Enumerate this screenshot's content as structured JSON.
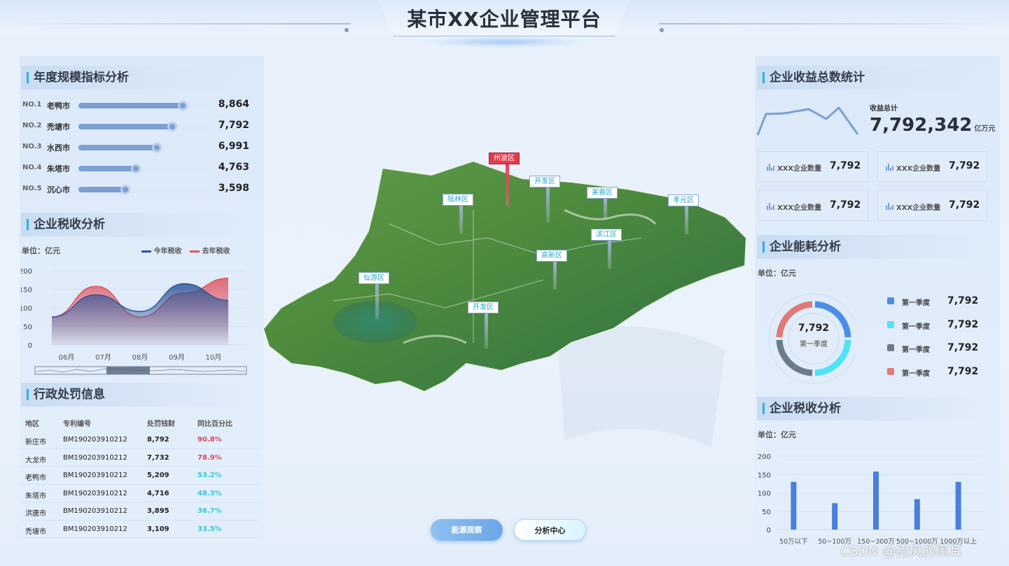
{
  "header": {
    "title": "某市XX企业管理平台"
  },
  "scale": {
    "title": "年度规模指标分析",
    "rows": [
      {
        "no": "NO.1",
        "city": "老鸭市",
        "value": "8,864",
        "ratio": 0.8
      },
      {
        "no": "NO.2",
        "city": "禿塘市",
        "value": "7,792",
        "ratio": 0.72
      },
      {
        "no": "NO.3",
        "city": "水西市",
        "value": "6,991",
        "ratio": 0.6
      },
      {
        "no": "NO.4",
        "city": "朱塔市",
        "value": "4,763",
        "ratio": 0.44
      },
      {
        "no": "NO.5",
        "city": "沉心市",
        "value": "3,598",
        "ratio": 0.36
      }
    ]
  },
  "tax_left": {
    "title": "企业税收分析",
    "unit": "单位：亿元",
    "legend": [
      "今年税收",
      "去年税收"
    ],
    "colors": {
      "this_year": "#2f5597",
      "last_year": "#e0545f"
    },
    "chart_data": {
      "type": "area",
      "x": [
        "06月",
        "07月",
        "08月",
        "09月",
        "10月"
      ],
      "yticks": [
        0,
        50,
        100,
        150,
        200
      ],
      "ylim": [
        0,
        200
      ],
      "series": [
        {
          "name": "今年税收",
          "values": [
            75,
            135,
            90,
            165,
            120
          ]
        },
        {
          "name": "去年税收",
          "values": [
            75,
            158,
            75,
            140,
            180
          ]
        }
      ]
    }
  },
  "penalty": {
    "title": "行政处罚信息",
    "headers": [
      "地区",
      "专利编号",
      "处罚钱财",
      "同比百分比"
    ],
    "rows": [
      {
        "region": "新庄市",
        "code": "BM190203910212",
        "amount": "8,792",
        "pct": "90.8%",
        "hot": true
      },
      {
        "region": "大龙市",
        "code": "BM190203910212",
        "amount": "7,732",
        "pct": "78.9%",
        "hot": true
      },
      {
        "region": "老鸭市",
        "code": "BM190203910212",
        "amount": "5,209",
        "pct": "53.2%",
        "hot": false
      },
      {
        "region": "朱塔市",
        "code": "BM190203910212",
        "amount": "4,716",
        "pct": "48.3%",
        "hot": false
      },
      {
        "region": "洪唐市",
        "code": "BM190203910212",
        "amount": "3,895",
        "pct": "36.7%",
        "hot": false
      },
      {
        "region": "禿塘市",
        "code": "BM190203910212",
        "amount": "3,109",
        "pct": "33.5%",
        "hot": false
      }
    ]
  },
  "map": {
    "labels": [
      {
        "name": "州波区",
        "active": true
      },
      {
        "name": "开发区"
      },
      {
        "name": "陆林区"
      },
      {
        "name": "美蓉区"
      },
      {
        "name": "孝元区"
      },
      {
        "name": "滨江区"
      },
      {
        "name": "高新区"
      },
      {
        "name": "仙游区"
      },
      {
        "name": "开发区"
      }
    ]
  },
  "buttons": {
    "energy": "能源观察",
    "analysis": "分析中心"
  },
  "income": {
    "title": "企业收益总数统计",
    "label": "收益总计",
    "value": "7,792,342",
    "unit": "亿万元",
    "stats": [
      {
        "label": "XXX企业数量",
        "value": "7,792"
      },
      {
        "label": "XXX企业数量",
        "value": "7,792"
      },
      {
        "label": "XXX企业数量",
        "value": "7,792"
      },
      {
        "label": "XXX企业数量",
        "value": "7,792"
      }
    ]
  },
  "energy": {
    "title": "企业能耗分析",
    "unit": "单位：亿元",
    "center_value": "7,792",
    "center_label": "第一季度",
    "chart_data": {
      "type": "pie",
      "labels": [
        "第一季度",
        "第一季度",
        "第一季度",
        "第一季度"
      ],
      "values": [
        7792,
        7792,
        7792,
        7792
      ],
      "colors": [
        "#4a8ee8",
        "#4fe3f5",
        "#6b7b8c",
        "#e07a7a"
      ]
    },
    "legend": [
      {
        "label": "第一季度",
        "value": "7,792",
        "color": "#4a8ee8"
      },
      {
        "label": "第一季度",
        "value": "7,792",
        "color": "#4fe3f5"
      },
      {
        "label": "第一季度",
        "value": "7,792",
        "color": "#6b7b8c"
      },
      {
        "label": "第一季度",
        "value": "7,792",
        "color": "#e07a7a"
      }
    ]
  },
  "tax_right": {
    "title": "企业税收分析",
    "unit": "单位：亿元",
    "chart_data": {
      "type": "bar",
      "categories": [
        "50万以下",
        "50~100万",
        "150~300万",
        "500~1000万",
        "1000万以上"
      ],
      "values": [
        130,
        72,
        158,
        83,
        130
      ],
      "yticks": [
        0,
        50,
        100,
        150,
        200
      ],
      "ylim": [
        0,
        200
      ],
      "color": "#4a7fdb"
    }
  },
  "watermark": "CSDN @招风的黑耳"
}
